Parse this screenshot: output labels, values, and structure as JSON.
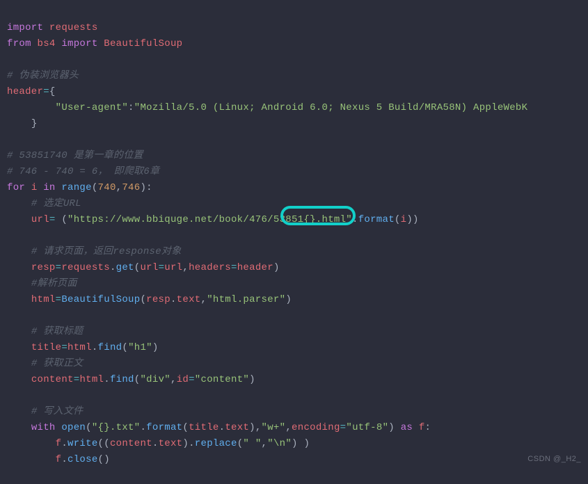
{
  "code": {
    "l1_kw1": "import",
    "l1_mod": "requests",
    "l2_kw1": "from",
    "l2_mod": "bs4",
    "l2_kw2": "import",
    "l2_cls": "BeautifulSoup",
    "l4_cmt": "# 伪装浏览器头",
    "l5_var": "header",
    "l5_brace": "{",
    "l5_eq": "=",
    "l6_key": "\"User-agent\"",
    "l6_colon": ":",
    "l6_val": "\"Mozilla/5.0 (Linux; Android 6.0; Nexus 5 Build/MRA58N) AppleWebK",
    "l7_brace": "}",
    "l9_cmt": "# 53851740 是第一章的位置",
    "l10_cmt": "# 746 - 740 = 6， 即爬取6章",
    "l11_for": "for",
    "l11_i": "i",
    "l11_in": "in",
    "l11_range": "range",
    "l11_n1": "740",
    "l11_n2": "746",
    "l11_c": ",",
    "l11_colon": ":",
    "l12_cmt": "# 选定URL",
    "l13_url": "url",
    "l13_eq": "=",
    "l13_str": "\"https://www.bbiquge.net/book/476/53851{}.html\"",
    "l13_format": "format",
    "l13_i": "i",
    "l14_cmt": "# 请求页面，返回response对象",
    "l15_resp": "resp",
    "l15_eq": "=",
    "l15_requests": "requests",
    "l15_get": "get",
    "l15_urlp": "url",
    "l15_urlv": "url",
    "l15_hdp": "headers",
    "l15_hdv": "header",
    "l16_cmt": "#解析页面",
    "l17_html": "html",
    "l17_eq": "=",
    "l17_bs": "BeautifulSoup",
    "l17_resp": "resp",
    "l17_text": "text",
    "l17_parser": "\"html.parser\"",
    "l18_cmt": "# 获取标题",
    "l19_title": "title",
    "l19_eq": "=",
    "l19_html": "html",
    "l19_find": "find",
    "l19_h1": "\"h1\"",
    "l20_cmt": "# 获取正文",
    "l21_content": "content",
    "l21_eq": "=",
    "l21_html": "html",
    "l21_find": "find",
    "l21_div": "\"div\"",
    "l21_idp": "id",
    "l21_idv": "\"content\"",
    "l22_cmt": "# 写入文件",
    "l23_with": "with",
    "l23_open": "open",
    "l23_path": "\"{}.txt\"",
    "l23_format": "format",
    "l23_title": "title",
    "l23_text": "text",
    "l23_mode": "\"w+\"",
    "l23_encp": "encoding",
    "l23_encv": "\"utf-8\"",
    "l23_as": "as",
    "l23_f": "f",
    "l24_f": "f",
    "l24_write": "write",
    "l24_content": "content",
    "l24_text": "text",
    "l24_replace": "replace",
    "l24_space": "\" \"",
    "l24_nl": "\"\\n\"",
    "l25_f": "f",
    "l25_close": "close"
  },
  "watermark": {
    "prefix": "CSDN ",
    "suffix": "@_H2_"
  }
}
